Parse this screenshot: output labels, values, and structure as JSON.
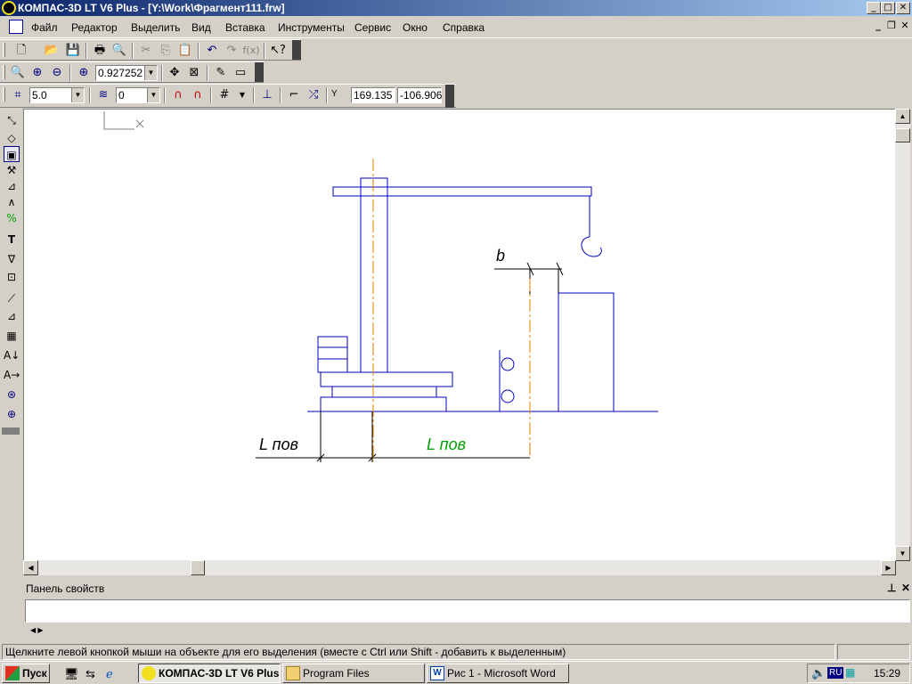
{
  "window": {
    "title": "КОМПАС-3D LT V6 Plus - [Y:\\Work\\Фрагмент111.frw]",
    "minimize": "_",
    "maximize": "□",
    "close": "✕"
  },
  "menu": {
    "items": [
      "Файл",
      "Редактор",
      "Выделить",
      "Вид",
      "Вставка",
      "Инструменты",
      "Сервис",
      "Окно",
      "Справка"
    ],
    "doc_minimize": "_",
    "doc_restore": "❐",
    "doc_close": "✕"
  },
  "toolbar_view": {
    "zoom_value": "0.927252"
  },
  "toolbar_params": {
    "step_value": "5.0",
    "layer_value": "0",
    "coord_label": "Y",
    "coord_x": "169.135",
    "coord_y": "-106.906"
  },
  "drawing": {
    "label_b": "b",
    "label_l_left": "L пов",
    "label_l_right": "L пов"
  },
  "properties_panel": {
    "title": "Панель свойств",
    "pin": "⊥",
    "close": "✕"
  },
  "status": {
    "message": "Щелкните левой кнопкой мыши на объекте для его выделения (вместе с Ctrl или Shift - добавить к выделенным)"
  },
  "taskbar": {
    "start_label": "Пуск",
    "tasks": [
      {
        "label": "КОМПАС-3D LT V6 Plus...",
        "icon": "kompas-icon"
      },
      {
        "label": "Program Files",
        "icon": "folder-icon"
      },
      {
        "label": "Рис 1  - Microsoft Word",
        "icon": "word-icon"
      }
    ],
    "lang": "RU",
    "clock": "15:29"
  },
  "colors": {
    "title_active": "#0a246a",
    "drawing_lines": "#0000c0",
    "axis_lines": "#e08000",
    "dimension_text": "#00a000"
  }
}
